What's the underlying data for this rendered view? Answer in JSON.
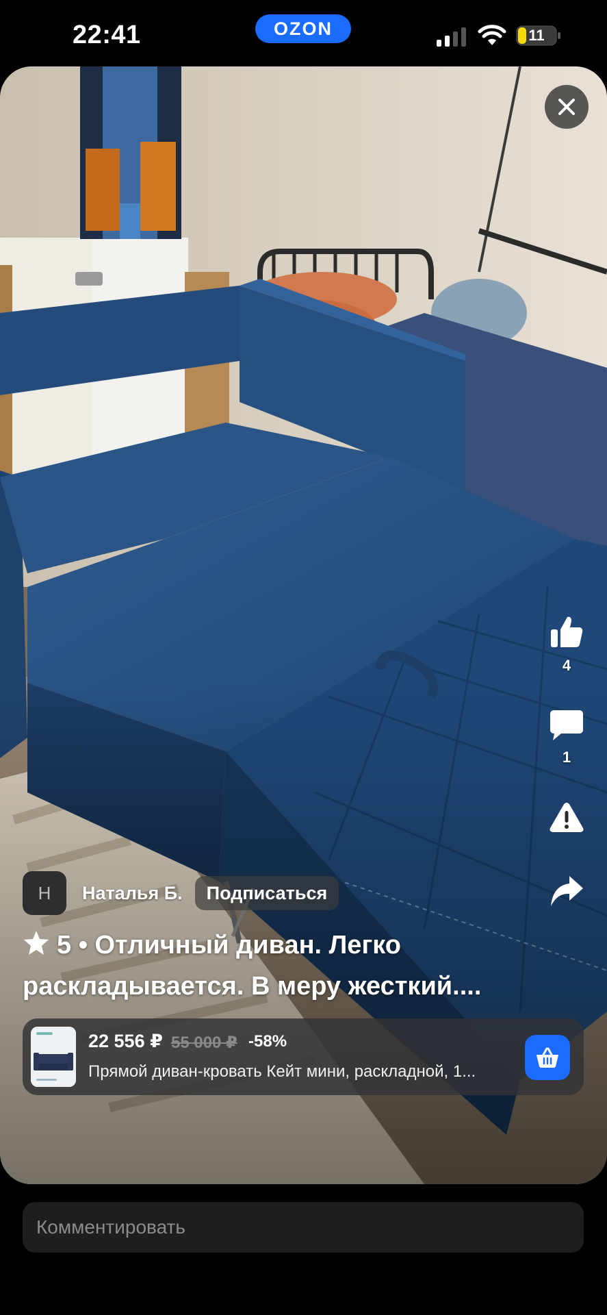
{
  "status_bar": {
    "time": "22:41",
    "brand": "OZON",
    "battery": "11",
    "icons": [
      "signal-icon",
      "wifi-icon",
      "battery-icon"
    ]
  },
  "video": {
    "close_icon": "close-icon",
    "actions": {
      "like_count": "4",
      "comment_count": "1",
      "icons": [
        "thumbs-up-icon",
        "comment-icon",
        "warning-icon",
        "share-icon"
      ]
    }
  },
  "author": {
    "avatar_initial": "Н",
    "name": "Наталья Б.",
    "subscribe_label": "Подписаться"
  },
  "review": {
    "rating": "5",
    "line1": "5 • Отличный диван. Легко",
    "line2": "раскладывается. В меру жесткий...."
  },
  "product": {
    "price": "22 556 ₽",
    "old_price": "55 000 ₽",
    "discount": "-58%",
    "title": "Прямой диван-кровать Кейт мини, раскладной, 1...",
    "cart_icon": "basket-icon"
  },
  "comment": {
    "placeholder": "Комментировать"
  },
  "colors": {
    "accent": "#1a6cff",
    "background": "#000000"
  }
}
